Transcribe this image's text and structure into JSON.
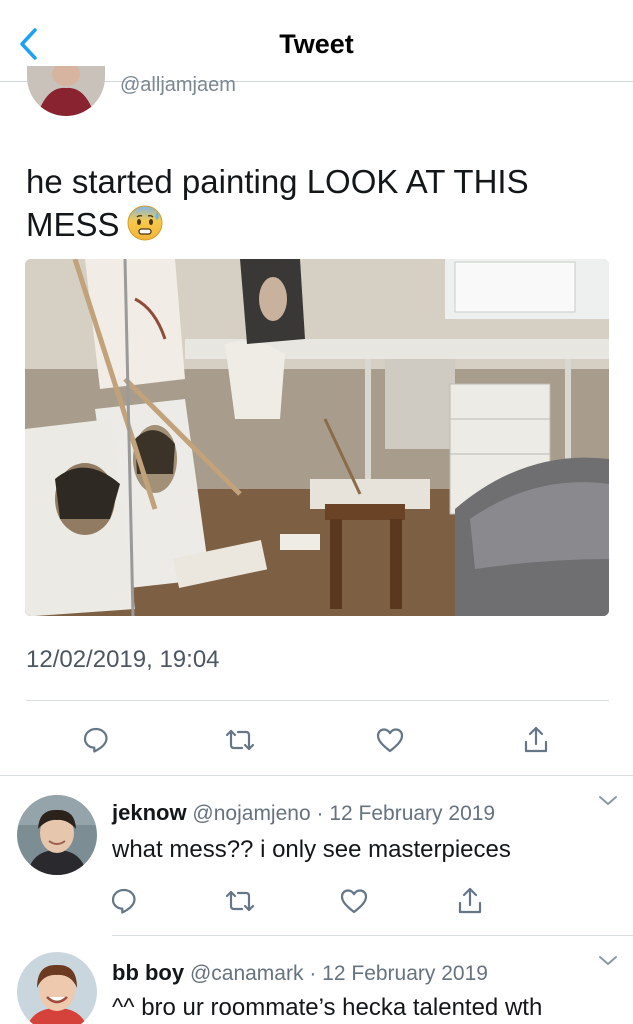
{
  "header": {
    "title": "Tweet"
  },
  "tweet": {
    "handle": "@alljamjaem",
    "text": "he started painting LOOK AT THIS MESS",
    "emoji": "anxious-face-with-sweat",
    "timestamp": "12/02/2019, 19:04",
    "actions": [
      "reply-icon",
      "retweet-icon",
      "like-icon",
      "share-icon"
    ]
  },
  "replies": [
    {
      "name": "jeknow",
      "handle": "@nojamjeno",
      "separator": "·",
      "date": "12 February 2019",
      "text": "what mess?? i only see masterpieces"
    },
    {
      "name": "bb boy",
      "handle": "@canamark",
      "separator": "·",
      "date": "12 February 2019",
      "text": "^^ bro ur roommate’s hecka talented wth"
    }
  ],
  "colors": {
    "accent": "#1da1f2",
    "icon": "#657786",
    "text": "#14171a",
    "secondary": "#657786"
  }
}
